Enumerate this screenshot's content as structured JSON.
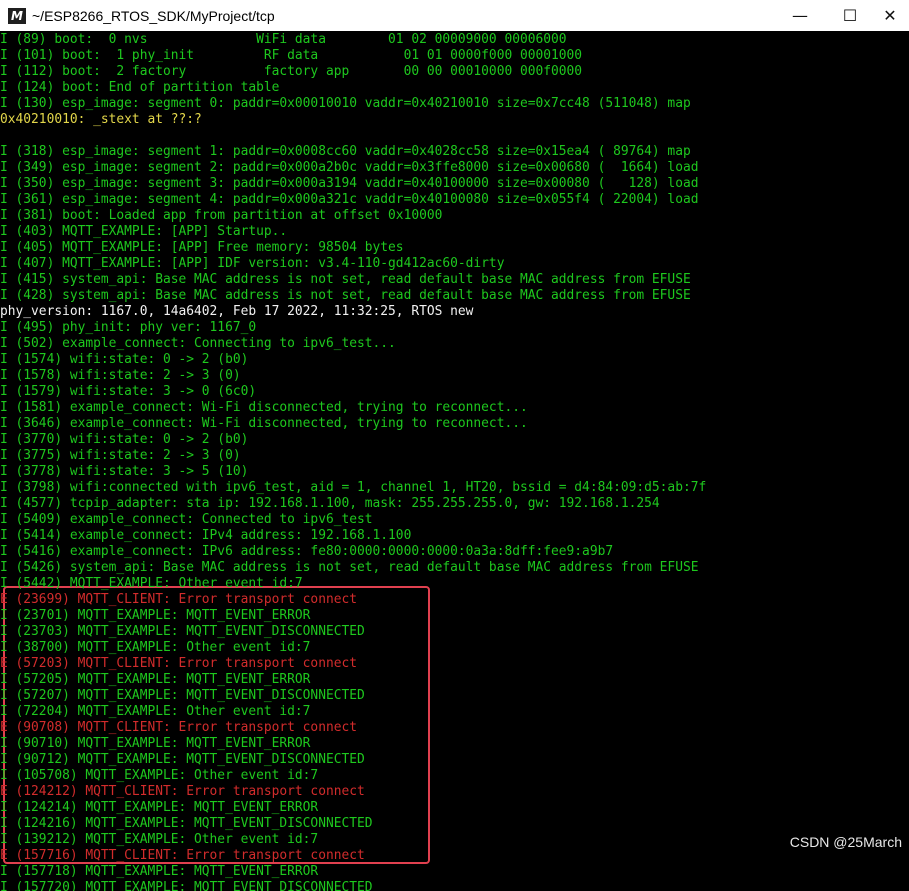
{
  "window": {
    "title": "~/ESP8266_RTOS_SDK/MyProject/tcp",
    "app_icon_glyph": "M",
    "minimize_glyph": "—",
    "maximize_glyph": "☐",
    "close_glyph": "✕"
  },
  "terminal": {
    "lines": [
      {
        "text": "I (89) boot:  0 nvs              WiFi data        01 02 00009000 00006000",
        "color": "green"
      },
      {
        "text": "I (101) boot:  1 phy_init         RF data           01 01 0000f000 00001000",
        "color": "green"
      },
      {
        "text": "I (112) boot:  2 factory          factory app       00 00 00010000 000f0000",
        "color": "green"
      },
      {
        "text": "I (124) boot: End of partition table",
        "color": "green"
      },
      {
        "text": "I (130) esp_image: segment 0: paddr=0x00010010 vaddr=0x40210010 size=0x7cc48 (511048) map",
        "color": "green"
      },
      {
        "text": "0x40210010: _stext at ??:?",
        "color": "yellow"
      },
      {
        "text": "",
        "color": "green"
      },
      {
        "text": "I (318) esp_image: segment 1: paddr=0x0008cc60 vaddr=0x4028cc58 size=0x15ea4 ( 89764) map",
        "color": "green"
      },
      {
        "text": "I (349) esp_image: segment 2: paddr=0x000a2b0c vaddr=0x3ffe8000 size=0x00680 (  1664) load",
        "color": "green"
      },
      {
        "text": "I (350) esp_image: segment 3: paddr=0x000a3194 vaddr=0x40100000 size=0x00080 (   128) load",
        "color": "green"
      },
      {
        "text": "I (361) esp_image: segment 4: paddr=0x000a321c vaddr=0x40100080 size=0x055f4 ( 22004) load",
        "color": "green"
      },
      {
        "text": "I (381) boot: Loaded app from partition at offset 0x10000",
        "color": "green"
      },
      {
        "text": "I (403) MQTT_EXAMPLE: [APP] Startup..",
        "color": "green"
      },
      {
        "text": "I (405) MQTT_EXAMPLE: [APP] Free memory: 98504 bytes",
        "color": "green"
      },
      {
        "text": "I (407) MQTT_EXAMPLE: [APP] IDF version: v3.4-110-gd412ac60-dirty",
        "color": "green"
      },
      {
        "text": "I (415) system_api: Base MAC address is not set, read default base MAC address from EFUSE",
        "color": "green"
      },
      {
        "text": "I (428) system_api: Base MAC address is not set, read default base MAC address from EFUSE",
        "color": "green"
      },
      {
        "text": "phy_version: 1167.0, 14a6402, Feb 17 2022, 11:32:25, RTOS new",
        "color": "white"
      },
      {
        "text": "I (495) phy_init: phy ver: 1167_0",
        "color": "green"
      },
      {
        "text": "I (502) example_connect: Connecting to ipv6_test...",
        "color": "green"
      },
      {
        "text": "I (1574) wifi:state: 0 -> 2 (b0)",
        "color": "green"
      },
      {
        "text": "I (1578) wifi:state: 2 -> 3 (0)",
        "color": "green"
      },
      {
        "text": "I (1579) wifi:state: 3 -> 0 (6c0)",
        "color": "green"
      },
      {
        "text": "I (1581) example_connect: Wi-Fi disconnected, trying to reconnect...",
        "color": "green"
      },
      {
        "text": "I (3646) example_connect: Wi-Fi disconnected, trying to reconnect...",
        "color": "green"
      },
      {
        "text": "I (3770) wifi:state: 0 -> 2 (b0)",
        "color": "green"
      },
      {
        "text": "I (3775) wifi:state: 2 -> 3 (0)",
        "color": "green"
      },
      {
        "text": "I (3778) wifi:state: 3 -> 5 (10)",
        "color": "green"
      },
      {
        "text": "I (3798) wifi:connected with ipv6_test, aid = 1, channel 1, HT20, bssid = d4:84:09:d5:ab:7f",
        "color": "green"
      },
      {
        "text": "I (4577) tcpip_adapter: sta ip: 192.168.1.100, mask: 255.255.255.0, gw: 192.168.1.254",
        "color": "green"
      },
      {
        "text": "I (5409) example_connect: Connected to ipv6_test",
        "color": "green"
      },
      {
        "text": "I (5414) example_connect: IPv4 address: 192.168.1.100",
        "color": "green"
      },
      {
        "text": "I (5416) example_connect: IPv6 address: fe80:0000:0000:0000:0a3a:8dff:fee9:a9b7",
        "color": "green"
      },
      {
        "text": "I (5426) system_api: Base MAC address is not set, read default base MAC address from EFUSE",
        "color": "green"
      },
      {
        "text": "I (5442) MQTT_EXAMPLE: Other event id:7",
        "color": "green"
      },
      {
        "text": "E (23699) MQTT_CLIENT: Error transport connect",
        "color": "red"
      },
      {
        "text": "I (23701) MQTT_EXAMPLE: MQTT_EVENT_ERROR",
        "color": "green"
      },
      {
        "text": "I (23703) MQTT_EXAMPLE: MQTT_EVENT_DISCONNECTED",
        "color": "green"
      },
      {
        "text": "I (38700) MQTT_EXAMPLE: Other event id:7",
        "color": "green"
      },
      {
        "text": "E (57203) MQTT_CLIENT: Error transport connect",
        "color": "red"
      },
      {
        "text": "I (57205) MQTT_EXAMPLE: MQTT_EVENT_ERROR",
        "color": "green"
      },
      {
        "text": "I (57207) MQTT_EXAMPLE: MQTT_EVENT_DISCONNECTED",
        "color": "green"
      },
      {
        "text": "I (72204) MQTT_EXAMPLE: Other event id:7",
        "color": "green"
      },
      {
        "text": "E (90708) MQTT_CLIENT: Error transport connect",
        "color": "red"
      },
      {
        "text": "I (90710) MQTT_EXAMPLE: MQTT_EVENT_ERROR",
        "color": "green"
      },
      {
        "text": "I (90712) MQTT_EXAMPLE: MQTT_EVENT_DISCONNECTED",
        "color": "green"
      },
      {
        "text": "I (105708) MQTT_EXAMPLE: Other event id:7",
        "color": "green"
      },
      {
        "text": "E (124212) MQTT_CLIENT: Error transport connect",
        "color": "red"
      },
      {
        "text": "I (124214) MQTT_EXAMPLE: MQTT_EVENT_ERROR",
        "color": "green"
      },
      {
        "text": "I (124216) MQTT_EXAMPLE: MQTT_EVENT_DISCONNECTED",
        "color": "green"
      },
      {
        "text": "I (139212) MQTT_EXAMPLE: Other event id:7",
        "color": "green"
      },
      {
        "text": "E (157716) MQTT_CLIENT: Error transport connect",
        "color": "red"
      },
      {
        "text": "I (157718) MQTT_EXAMPLE: MQTT_EVENT_ERROR",
        "color": "green"
      },
      {
        "text": "I (157720) MQTT_EXAMPLE: MQTT_EVENT_DISCONNECTED",
        "color": "green"
      }
    ]
  },
  "watermark": "CSDN @25March",
  "colors": {
    "terminal_bg": "#000000",
    "green": "#1ec81e",
    "yellow": "#e2d64a",
    "white": "#f2f2f2",
    "red": "#d22c2c",
    "highlight_border": "#e0404f"
  }
}
